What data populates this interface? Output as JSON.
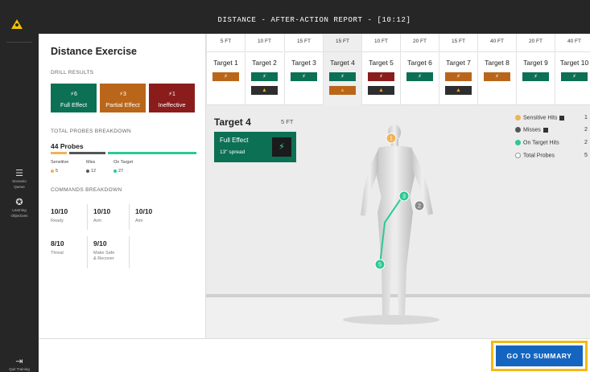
{
  "sidebar": {
    "items": [
      {
        "icon": "list-icon",
        "label_line1": "Scenario",
        "label_line2": "Queue"
      },
      {
        "icon": "target-icon",
        "label_line1": "Learning",
        "label_line2": "Objectives"
      }
    ],
    "exit": {
      "icon": "exit-icon",
      "label": "Quit Training"
    }
  },
  "header": {
    "title": "DISTANCE - AFTER-ACTION REPORT - [10:12]"
  },
  "summary": {
    "title": "Distance Exercise",
    "drill_results_label": "DRILL RESULTS",
    "drill": [
      {
        "count": "⚡6",
        "label": "Full Effect",
        "color": "#0c7055"
      },
      {
        "count": "⚡3",
        "label": "Partial Effect",
        "color": "#b9661a"
      },
      {
        "count": "⚡1",
        "label": "Ineffective",
        "color": "#8b1c1c"
      }
    ],
    "probes_label": "TOTAL PROBES BREAKDOWN",
    "probes_total": "44 Probes",
    "probes": [
      {
        "name": "Sensitive",
        "value": "5",
        "color": "#f0b35a"
      },
      {
        "name": "Miss",
        "value": "12",
        "color": "#555555"
      },
      {
        "name": "On Target",
        "value": "27",
        "color": "#2ec895"
      }
    ],
    "commands_label": "COMMANDS BREAKDOWN",
    "commands": [
      {
        "value": "10/10",
        "label": "Ready"
      },
      {
        "value": "10/10",
        "label": "Arm"
      },
      {
        "value": "10/10",
        "label": "Aim"
      },
      {
        "value": "8/10",
        "label": "Threat"
      },
      {
        "value": "9/10",
        "label_line1": "Make Safe",
        "label_line2": "& Recover"
      }
    ]
  },
  "targets": [
    {
      "distance": "5 FT",
      "name": "Target 1",
      "chips": [
        {
          "type": "partial"
        }
      ]
    },
    {
      "distance": "10 FT",
      "name": "Target 2",
      "chips": [
        {
          "type": "full"
        },
        {
          "type": "warn-dark"
        }
      ]
    },
    {
      "distance": "15 FT",
      "name": "Target 3",
      "chips": [
        {
          "type": "full"
        }
      ]
    },
    {
      "distance": "15 FT",
      "name": "Target 4",
      "chips": [
        {
          "type": "full"
        },
        {
          "type": "warn-orange"
        }
      ]
    },
    {
      "distance": "10 FT",
      "name": "Target 5",
      "chips": [
        {
          "type": "ineffective"
        },
        {
          "type": "warn-dark"
        }
      ]
    },
    {
      "distance": "20 FT",
      "name": "Target 6",
      "chips": [
        {
          "type": "full"
        }
      ]
    },
    {
      "distance": "15 FT",
      "name": "Target 7",
      "chips": [
        {
          "type": "partial"
        },
        {
          "type": "warn-dark"
        }
      ]
    },
    {
      "distance": "40 FT",
      "name": "Target 8",
      "chips": [
        {
          "type": "partial"
        }
      ]
    },
    {
      "distance": "20 FT",
      "name": "Target 9",
      "chips": [
        {
          "type": "full"
        }
      ]
    },
    {
      "distance": "40 FT",
      "name": "Target 10",
      "chips": [
        {
          "type": "full"
        }
      ]
    }
  ],
  "selected_target_index": 3,
  "detail": {
    "title": "Target 4",
    "distance": "5 FT",
    "effect": "Full Effect",
    "spread": "13\" spread"
  },
  "legend": [
    {
      "label": "Sensitive Hits",
      "value": "1",
      "color": "#f0b35a",
      "badge": true
    },
    {
      "label": "Misses",
      "value": "2",
      "color": "#555555",
      "badge": true
    },
    {
      "label": "On Target Hits",
      "value": "2",
      "color": "#2ec895",
      "badge": false
    },
    {
      "label": "Total Probes",
      "value": "5",
      "color": "",
      "badge": false
    }
  ],
  "hits": [
    {
      "label": "1",
      "color": "#f0b35a"
    },
    {
      "label": "3",
      "color": "#2ec895"
    },
    {
      "label": "2",
      "color": "#8a8a8a"
    },
    {
      "label": "5",
      "color": "#2ec895"
    }
  ],
  "footer": {
    "button_label": "GO TO SUMMARY"
  },
  "colors": {
    "full": "#0c7055",
    "partial": "#b9661a",
    "ineffective": "#8b1c1c",
    "dark": "#2e2e2e",
    "warn": "#f0a020",
    "accent_highlight": "#f5b914",
    "button": "#1565c0"
  }
}
